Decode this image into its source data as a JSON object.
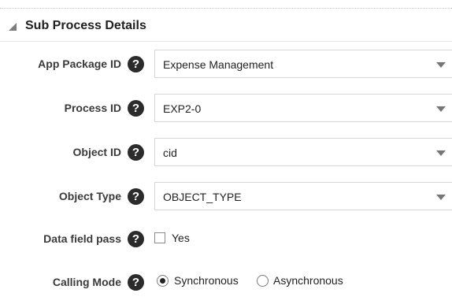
{
  "section": {
    "title": "Sub Process Details"
  },
  "fields": {
    "app_package": {
      "label": "App Package ID",
      "value": "Expense Management"
    },
    "process": {
      "label": "Process ID",
      "value": "EXP2-0"
    },
    "object_id": {
      "label": "Object ID",
      "value": "cid"
    },
    "object_type": {
      "label": "Object Type",
      "value": "OBJECT_TYPE"
    },
    "data_field_pass": {
      "label": "Data field pass",
      "option": "Yes",
      "checked": false
    },
    "calling_mode": {
      "label": "Calling Mode",
      "options": [
        "Synchronous",
        "Asynchronous"
      ],
      "selected": "Synchronous"
    }
  },
  "help_glyph": "?",
  "icons": {
    "help": "question-circle-icon",
    "dropdown": "chevron-down-icon",
    "collapse": "collapse-triangle-icon"
  }
}
